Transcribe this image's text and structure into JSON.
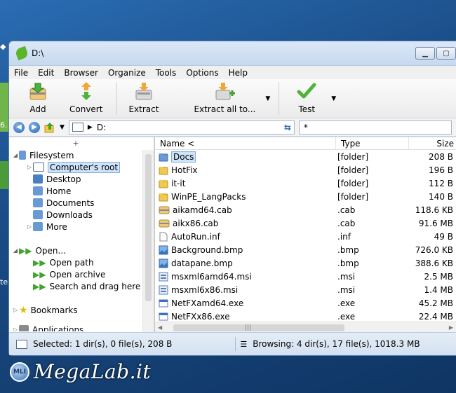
{
  "window": {
    "title": "D:\\"
  },
  "menu": [
    "File",
    "Edit",
    "Browser",
    "Organize",
    "Tools",
    "Options",
    "Help"
  ],
  "toolbar": {
    "add": "Add",
    "convert": "Convert",
    "extract": "Extract",
    "extract_all": "Extract all to...",
    "test": "Test"
  },
  "address": {
    "path": "D:",
    "filter": "*"
  },
  "tree": {
    "up": "+",
    "filesystem": "Filesystem",
    "computer_root": "Computer's root",
    "desktop": "Desktop",
    "home": "Home",
    "documents": "Documents",
    "downloads": "Downloads",
    "more": "More",
    "open": "Open...",
    "open_path": "Open path",
    "open_archive": "Open archive",
    "search_drag": "Search and drag here",
    "bookmarks": "Bookmarks",
    "applications": "Applications"
  },
  "columns": {
    "name": "Name <",
    "type": "Type",
    "size": "Size"
  },
  "files": [
    {
      "name": "Docs",
      "type": "[folder]",
      "size": "208 B",
      "icon": "folder-blue"
    },
    {
      "name": "HotFix",
      "type": "[folder]",
      "size": "196 B",
      "icon": "folder"
    },
    {
      "name": "it-it",
      "type": "[folder]",
      "size": "112 B",
      "icon": "folder"
    },
    {
      "name": "WinPE_LangPacks",
      "type": "[folder]",
      "size": "140 B",
      "icon": "folder"
    },
    {
      "name": "aikamd64.cab",
      "type": ".cab",
      "size": "118.6 KB",
      "icon": "cab"
    },
    {
      "name": "aikx86.cab",
      "type": ".cab",
      "size": "91.6 MB",
      "icon": "cab"
    },
    {
      "name": "AutoRun.inf",
      "type": ".inf",
      "size": "49 B",
      "icon": "file"
    },
    {
      "name": "Background.bmp",
      "type": ".bmp",
      "size": "726.0 KB",
      "icon": "image"
    },
    {
      "name": "datapane.bmp",
      "type": ".bmp",
      "size": "388.6 KB",
      "icon": "image"
    },
    {
      "name": "msxml6amd64.msi",
      "type": ".msi",
      "size": "2.5 MB",
      "icon": "msi"
    },
    {
      "name": "msxml6x86.msi",
      "type": ".msi",
      "size": "1.4 MB",
      "icon": "msi"
    },
    {
      "name": "NetFXamd64.exe",
      "type": ".exe",
      "size": "45.2 MB",
      "icon": "exe"
    },
    {
      "name": "NetFXx86.exe",
      "type": ".exe",
      "size": "22.4 MB",
      "icon": "exe"
    }
  ],
  "status": {
    "selected": "Selected: 1 dir(s), 0 file(s), 208 B",
    "browsing": "Browsing: 4 dir(s), 17 file(s), 1018.3 MB"
  },
  "watermark": {
    "text": "MegaLab.it",
    "badge": "MLI"
  },
  "desktop": {
    "glyph1": "6.",
    "glyph2": "te"
  },
  "colors": {
    "selection": "#cfe3fb",
    "folder_yellow": "#f2c94c",
    "folder_blue": "#6a9ad6",
    "accent_green": "#3fa32c"
  }
}
